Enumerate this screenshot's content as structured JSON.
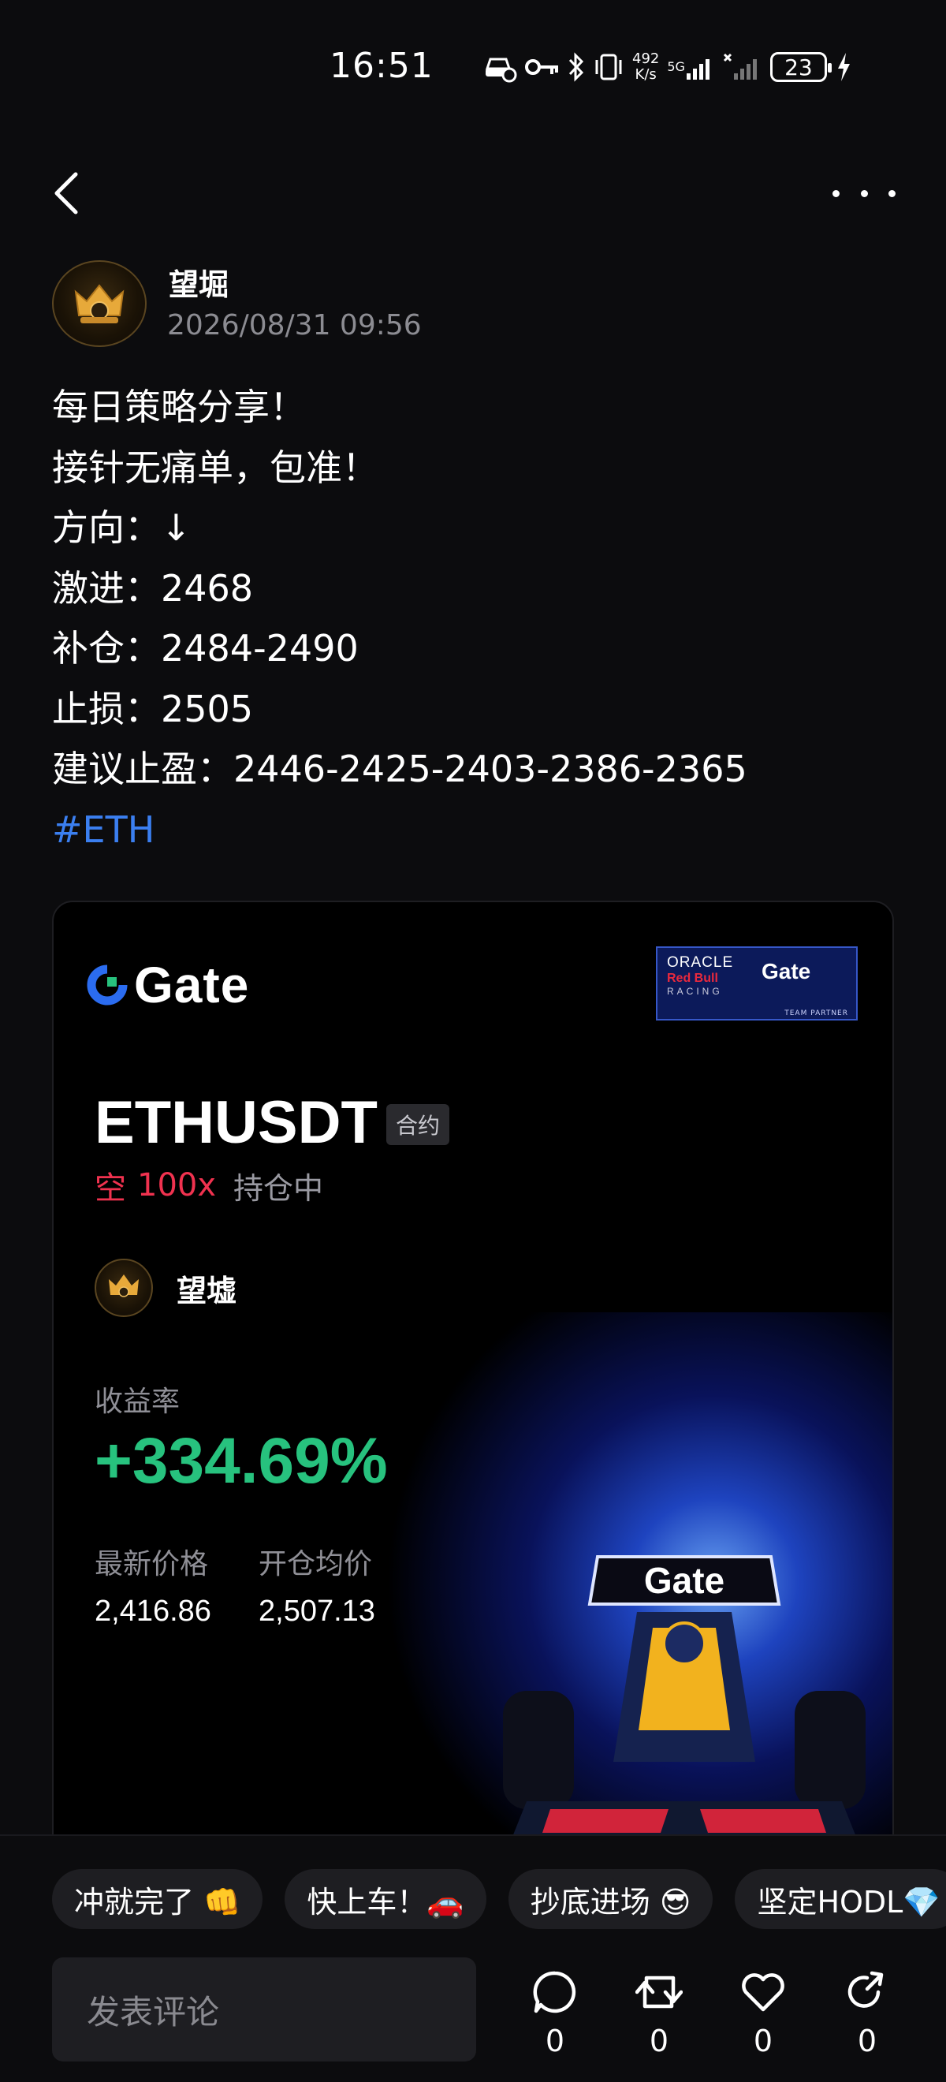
{
  "status_bar": {
    "time": "16:51",
    "net_speed_value": "492",
    "net_speed_unit": "K/s",
    "net_type": "5G",
    "battery": "23",
    "icons": [
      "car-mode-icon",
      "key-icon",
      "bluetooth-icon",
      "vibrate-icon",
      "signal-icon",
      "signal-no-service-icon",
      "charging-icon"
    ]
  },
  "header": {
    "back_icon": "chevron-left-icon",
    "more_icon": "more-horizontal-icon"
  },
  "post": {
    "author": "望堀",
    "time": "2026/08/31 09:56",
    "lines": [
      "每日策略分享！",
      "接针无痛单，包准！",
      "方向：↓",
      "激进：2468",
      "补仓：2484-2490",
      "止损：2505",
      "建议止盈：2446-2425-2403-2386-2365"
    ],
    "hashtag": "#ETH"
  },
  "card": {
    "brand": "Gate",
    "partner": {
      "oracle": "ORACLE",
      "red_bull": "Red Bull",
      "racing": "RACING",
      "gate": "Gate",
      "footer": "TEAM PARTNER"
    },
    "symbol": "ETHUSDT",
    "contract_tag": "合约",
    "direction": "空",
    "leverage": "100x",
    "position_status": "持仓中",
    "user": "望墟",
    "roi_label": "收益率",
    "roi_value": "+334.69%",
    "latest_price_label": "最新价格",
    "latest_price": "2,416.86",
    "entry_price_label": "开仓均价",
    "entry_price": "2,507.13",
    "colors": {
      "short": "#f0324f",
      "profit": "#27c27e",
      "accent": "#3b7ff0"
    }
  },
  "bottom": {
    "chips": [
      "冲就完了 👊",
      "快上车！🚗",
      "抄底进场 😎",
      "坚定HODL💎"
    ],
    "comment_placeholder": "发表评论",
    "actions": [
      {
        "icon": "comment-icon",
        "count": "0"
      },
      {
        "icon": "repost-icon",
        "count": "0"
      },
      {
        "icon": "like-heart-icon",
        "count": "0"
      },
      {
        "icon": "share-icon",
        "count": "0"
      }
    ]
  }
}
